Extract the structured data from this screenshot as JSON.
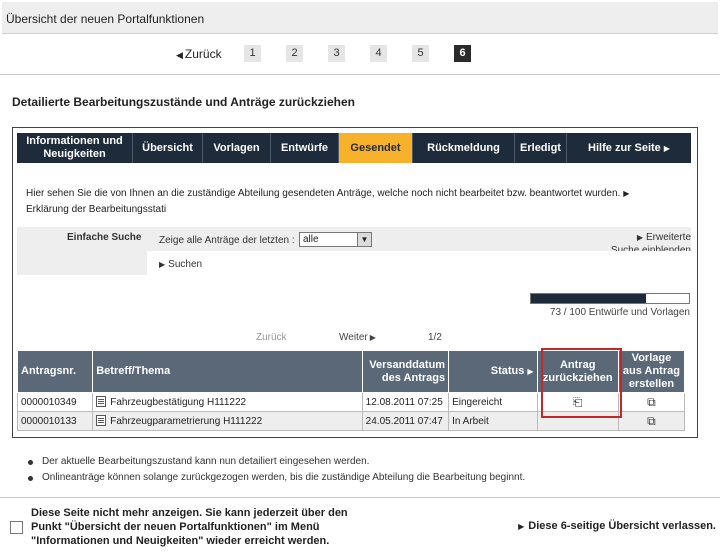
{
  "header": {
    "title": "Übersicht der neuen Portalfunktionen"
  },
  "pager": {
    "back_label": "Zurück",
    "pages": [
      "1",
      "2",
      "3",
      "4",
      "5",
      "6"
    ],
    "active_page": "6"
  },
  "subtitle": "Detailierte Bearbeitungszustände und Anträge zurückziehen",
  "tabs": [
    {
      "label": "Informationen und Neuigkeiten"
    },
    {
      "label": "Übersicht"
    },
    {
      "label": "Vorlagen"
    },
    {
      "label": "Entwürfe"
    },
    {
      "label": "Gesendet"
    },
    {
      "label": "Rückmeldung"
    },
    {
      "label": "Erledigt"
    },
    {
      "label": "Hilfe zur Seite"
    }
  ],
  "active_tab": "Gesendet",
  "intro": {
    "text": "Hier sehen Sie die von Ihnen an die zuständige Abteilung gesendeten Anträge, welche noch nicht bearbeitet bzw. beantwortet wurden.",
    "link": "Erklärung der Bearbeitungsstati"
  },
  "search": {
    "title": "Einfache Suche",
    "filter_label": "Zeige alle Anträge der letzten :",
    "filter_value": "alle",
    "advanced_line1": "Erweiterte",
    "advanced_line2": "Suche einblenden",
    "search_button": "Suchen"
  },
  "progress": {
    "label": "73 / 100 Entwürfe und Vorlagen",
    "value": 73,
    "max": 100
  },
  "list_nav": {
    "back": "Zurück",
    "forward": "Weiter",
    "page": "1/2"
  },
  "table": {
    "headers": {
      "nr": "Antragsnr.",
      "subject": "Betreff/Thema",
      "date": "Versanddatum des Antrags",
      "status": "Status",
      "withdraw": "Antrag zurückziehen",
      "template": "Vorlage aus Antrag erstellen"
    },
    "rows": [
      {
        "nr": "0000010349",
        "subject": "Fahrzeugbestätigung H111222",
        "date": "12.08.2011 07:25",
        "status": "Eingereicht"
      },
      {
        "nr": "0000010133",
        "subject": "Fahrzeugparametrierung H111222",
        "date": "24.05.2011 07:47",
        "status": "In Arbeit"
      }
    ]
  },
  "bullets": [
    "Der aktuelle Bearbeitungszustand kann nun detailiert eingesehen werden.",
    "Onlineanträge können solange zurückgezogen werden, bis die zuständige Abteilung die Bearbeitung beginnt."
  ],
  "footer": {
    "checkbox_text": "Diese Seite nicht mehr anzeigen. Sie kann jederzeit über den Punkt \"Übersicht der neuen Portalfunktionen\" im Menü \"Informationen und Neuigkeiten\" wieder erreicht werden.",
    "leave_label": "Diese 6-seitige Übersicht verlassen."
  },
  "colors": {
    "nav_bg": "#1e2b3a",
    "active_tab": "#f7b12a",
    "table_header": "#5a6878",
    "highlight": "#c42828"
  }
}
